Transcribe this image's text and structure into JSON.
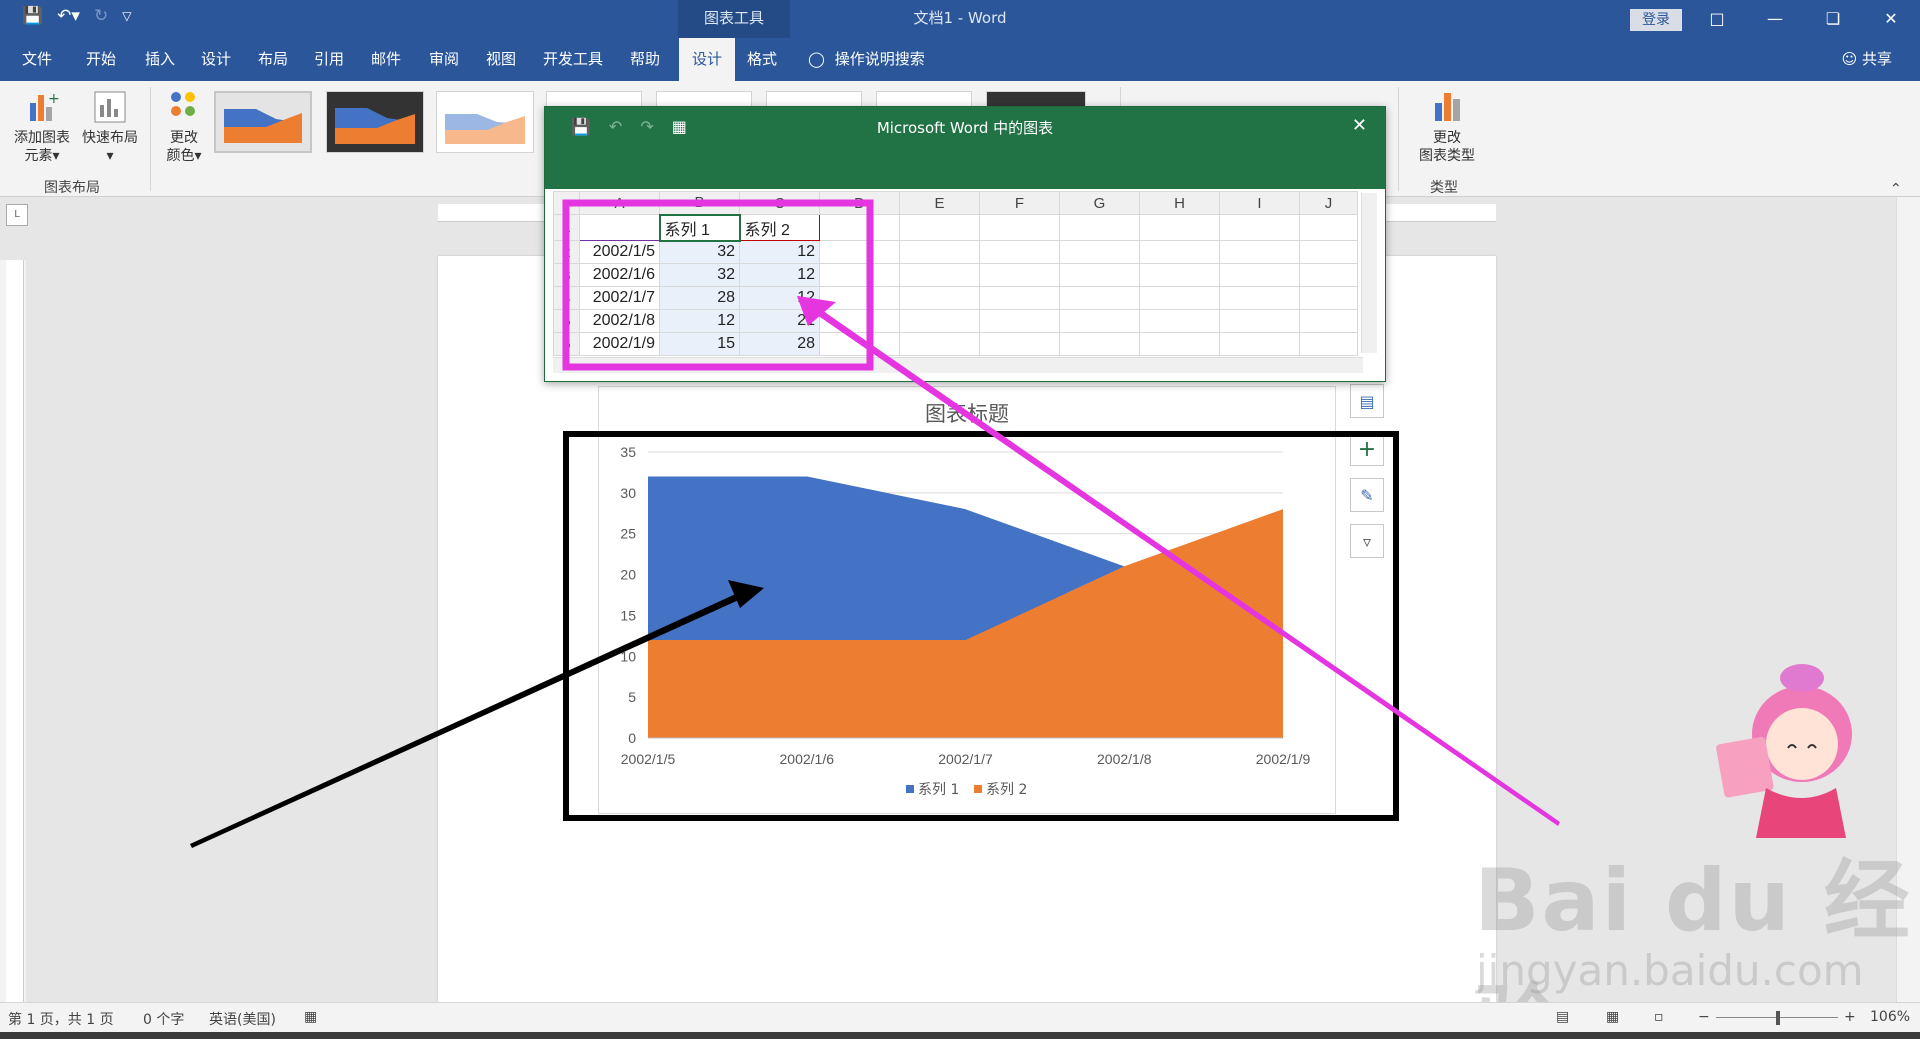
{
  "titlebar": {
    "context_tools": "图表工具",
    "title": "文档1 - Word",
    "login": "登录"
  },
  "ribbon_tabs": [
    {
      "label": "文件"
    },
    {
      "label": "开始"
    },
    {
      "label": "插入"
    },
    {
      "label": "设计"
    },
    {
      "label": "布局"
    },
    {
      "label": "引用"
    },
    {
      "label": "邮件"
    },
    {
      "label": "审阅"
    },
    {
      "label": "视图"
    },
    {
      "label": "开发工具"
    },
    {
      "label": "帮助"
    },
    {
      "label": "设计",
      "active": true
    },
    {
      "label": "格式"
    }
  ],
  "tell_me": "操作说明搜索",
  "share": "共享",
  "ribbon": {
    "add_element_line1": "添加图表",
    "add_element_line2": "元素",
    "quick_layout": "快速布局",
    "change_color_line1": "更改",
    "change_color_line2": "颜色",
    "group_layout": "图表布局",
    "change_type_line1": "更改",
    "change_type_line2": "图表类型",
    "group_type": "类型"
  },
  "datasheet": {
    "title": "Microsoft Word 中的图表",
    "columns": [
      "A",
      "B",
      "C",
      "D",
      "E",
      "F",
      "G",
      "H",
      "I",
      "J"
    ],
    "rows": [
      {
        "num": "1",
        "cells": [
          "",
          "系列 1",
          "系列 2"
        ]
      },
      {
        "num": "2",
        "cells": [
          "2002/1/5",
          "32",
          "12"
        ]
      },
      {
        "num": "3",
        "cells": [
          "2002/1/6",
          "32",
          "12"
        ]
      },
      {
        "num": "4",
        "cells": [
          "2002/1/7",
          "28",
          "12"
        ]
      },
      {
        "num": "5",
        "cells": [
          "2002/1/8",
          "12",
          "21"
        ]
      },
      {
        "num": "6",
        "cells": [
          "2002/1/9",
          "15",
          "28"
        ]
      }
    ]
  },
  "chart_data": {
    "type": "area",
    "title": "图表标题",
    "categories": [
      "2002/1/5",
      "2002/1/6",
      "2002/1/7",
      "2002/1/8",
      "2002/1/9"
    ],
    "series": [
      {
        "name": "系列 1",
        "values": [
          32,
          32,
          28,
          12,
          15
        ],
        "color": "#4472c4"
      },
      {
        "name": "系列 2",
        "values": [
          12,
          12,
          12,
          21,
          28
        ],
        "color": "#ed7d31"
      }
    ],
    "ylim": [
      0,
      35
    ],
    "yticks": [
      "0",
      "5",
      "10",
      "15",
      "20",
      "25",
      "30",
      "35"
    ],
    "grid": true,
    "legend": "bottom"
  },
  "status": {
    "page": "第 1 页，共 1 页",
    "words": "0 个字",
    "language": "英语(美国)",
    "zoom": "106%"
  },
  "watermark": {
    "logo": "Bai du 经验",
    "url": "jingyan.baidu.com"
  },
  "colors": {
    "word_blue": "#2b579a",
    "excel_green": "#217346",
    "annotation_magenta": "#e535e0",
    "annotation_black": "#000000"
  }
}
